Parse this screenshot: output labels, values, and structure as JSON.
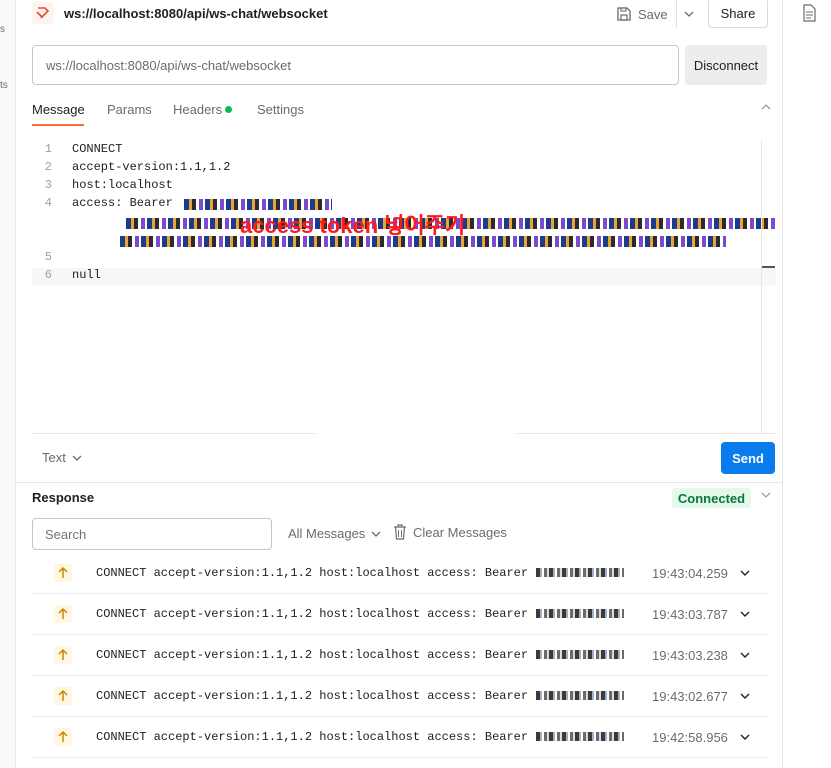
{
  "header": {
    "title": "ws://localhost:8080/api/ws-chat/websocket",
    "save_label": "Save",
    "share_label": "Share"
  },
  "connection": {
    "url_value": "ws://localhost:8080/api/ws-chat/websocket",
    "disconnect_label": "Disconnect"
  },
  "tabs": [
    {
      "label": "Message",
      "active": true
    },
    {
      "label": "Params",
      "active": false
    },
    {
      "label": "Headers",
      "active": false,
      "indicator": "green-dot"
    },
    {
      "label": "Settings",
      "active": false
    }
  ],
  "editor": {
    "lines": [
      {
        "number": "1",
        "text": "CONNECT"
      },
      {
        "number": "2",
        "text": "accept-version:1.1,1.2"
      },
      {
        "number": "3",
        "text": "host:localhost"
      },
      {
        "number": "4",
        "text": "access: Bearer "
      },
      {
        "number": "5",
        "text": ""
      },
      {
        "number": "6",
        "text": "null"
      }
    ],
    "annotation": "access token 넣어주기",
    "format_label": "Text",
    "send_label": "Send"
  },
  "response": {
    "title": "Response",
    "status": "Connected",
    "search_placeholder": "Search",
    "filter_label": "All Messages",
    "clear_label": "Clear Messages",
    "messages": [
      {
        "text": "CONNECT accept-version:1.1,1.2 host:localhost access: Bearer",
        "time": "19:43:04.259"
      },
      {
        "text": "CONNECT accept-version:1.1,1.2 host:localhost access: Bearer",
        "time": "19:43:03.787"
      },
      {
        "text": "CONNECT accept-version:1.1,1.2 host:localhost access: Bearer",
        "time": "19:43:03.238"
      },
      {
        "text": "CONNECT accept-version:1.1,1.2 host:localhost access: Bearer",
        "time": "19:43:02.677"
      },
      {
        "text": "CONNECT accept-version:1.1,1.2 host:localhost access: Bearer",
        "time": "19:42:58.956"
      }
    ]
  },
  "sidebar_fragments": [
    "s",
    "ts"
  ],
  "colors": {
    "accent": "#ff6c37",
    "send": "#097bed",
    "connected_bg": "#e5f8ec",
    "connected_text": "#067a39",
    "annotation": "#ff1a1a"
  }
}
